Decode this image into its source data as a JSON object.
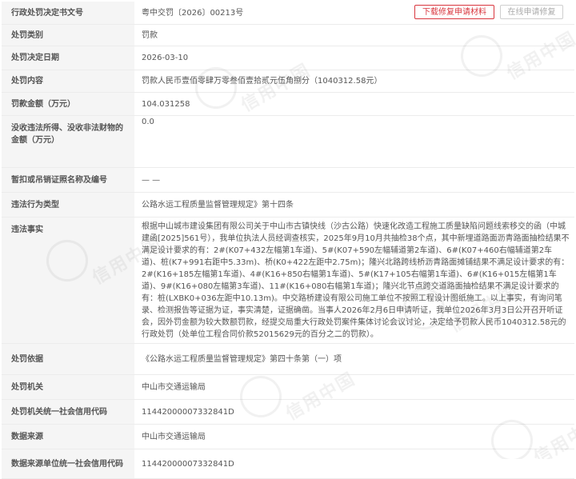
{
  "rows": {
    "doc_no": {
      "label": "行政处罚决定书文号",
      "value": "粤中交罚〔2026〕00213号"
    },
    "category": {
      "label": "处罚类别",
      "value": "罚款"
    },
    "date": {
      "label": "处罚决定日期",
      "value": "2026-03-10"
    },
    "content": {
      "label": "处罚内容",
      "value": "罚款人民币壹佰零肆万零叁佰壹拾贰元伍角捌分（1040312.58元）"
    },
    "amount": {
      "label": "罚款金额（万元）",
      "value": "104.031258"
    },
    "confiscated": {
      "label": "没收违法所得、没收非法财物的金额（万元）",
      "value": "0.0"
    },
    "suspend": {
      "label": "暂扣或吊销证照名称及编号",
      "value": "— —"
    },
    "violation_type": {
      "label": "违法行为类型",
      "value": "公路水运工程质量监督管理规定》第十四条"
    },
    "facts": {
      "label": "违法事实",
      "value": "根据中山城市建设集团有限公司关于中山市古镇快线（沙古公路）快速化改造工程施工质量缺陷问题线索移交的函（中城建函[2025]561号），我单位执法人员经调查核实，2025年9月10月共抽检38个点，其中新埋道路面沥青路面抽检结果不满足设计要求的有：2#(K07+432左幅第1车道)、5#(K07+590左幅辅道第2车道)、6#(K07+460右幅辅道第2车道)、桩(K7+991右距中5.33m)、桥(K0+422左距中2.75m)；隆兴北路跨线桥沥青路面摊铺结果不满足设计要求的有：2#(K16+185左幅第1车道)、4#(K16+850右幅第1车道)、5#(K17+105右幅第1车道)、6#(K16+015左幅第1车道)、9#(K16+080左幅第3车道)、11#(K16+080右幅第1车道)；隆兴北节点跨交道路面抽检结果不满足设计要求的有：桩(LXBK0+036左距中10.13m)。中交路桥建设有限公司施工单位不按照工程设计图纸施工。以上事实，有询问笔录、检测报告等证据为证，事实清楚，证据确凿。当事人2026年2月6日申请听证，我单位2026年3月3日公开召开听证会，因外罚金额为较大数额罚款，经提交局重大行政处罚案件集体讨论会议讨论，决定给予罚款人民币1040312.58元的行政处罚（处单位工程合同价款52015629元的百分之二的罚款）。"
    },
    "basis": {
      "label": "处罚依据",
      "value": "《公路水运工程质量监督管理规定》第四十条第（一）项"
    },
    "authority": {
      "label": "处罚机关",
      "value": "中山市交通运输局"
    },
    "authority_code": {
      "label": "处罚机关统一社会信用代码",
      "value": "11442000007332841D"
    },
    "source": {
      "label": "数据来源",
      "value": "中山市交通运输局"
    },
    "source_code": {
      "label": "数据来源单位统一社会信用代码",
      "value": "11442000007332841D"
    }
  },
  "buttons": {
    "download": "下载修复申请材料",
    "apply": "在线申请修复"
  },
  "watermark": "信用中国",
  "colors": {
    "accent": "#d9363e",
    "label_bg": "#f5f5f5",
    "border": "#ececec"
  }
}
